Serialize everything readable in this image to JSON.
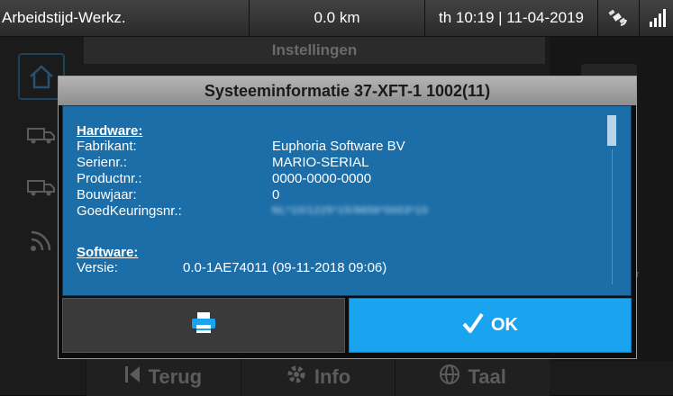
{
  "statusbar": {
    "mode": "Arbeidstijd-Werkz.",
    "distance": "0.0 km",
    "datetime": "th 10:19 | 11-04-2019",
    "gps_icon": "satellite-icon",
    "signal_icon": "signal-bars-icon"
  },
  "background": {
    "title": "Instellingen",
    "side_icons": [
      "home-icon",
      "truck-icon",
      "truck-icon",
      "signal-icon"
    ],
    "side_text": "er",
    "bottom": {
      "back_label": "Terug",
      "info_label": "Info",
      "language_label": "Taal"
    }
  },
  "dialog": {
    "title": "Systeeminformatie  37-XFT-1 1002(11)",
    "hardware": {
      "heading": "Hardware:",
      "rows": [
        {
          "key": "Fabrikant:",
          "value": "Euphoria Software BV"
        },
        {
          "key": "Serienr.:",
          "value": "MARIO-SERIAL"
        },
        {
          "key": "Productnr.:",
          "value": "0000-0000-0000"
        },
        {
          "key": "Bouwjaar:",
          "value": "0"
        },
        {
          "key": "GoedKeuringsnr.:",
          "value": "NL*10/1225*15/9656*0003*10"
        }
      ]
    },
    "software": {
      "heading": "Software:",
      "rows": [
        {
          "key": "Versie:",
          "value": "0.0-1AE74011 (09-11-2018 09:06)"
        }
      ]
    },
    "buttons": {
      "print_icon": "printer-icon",
      "ok_label": "OK",
      "ok_icon": "checkmark-icon"
    }
  },
  "colors": {
    "accent": "#1aa3ef",
    "panel": "#1c6ea8",
    "title_bar": "#a3a3a3"
  }
}
